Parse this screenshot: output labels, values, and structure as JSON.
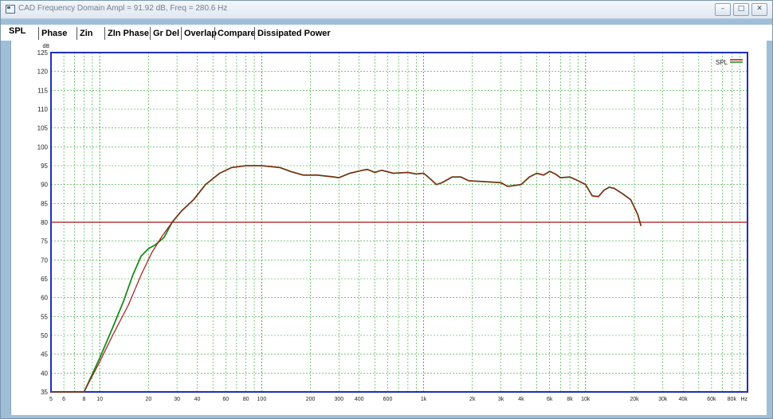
{
  "window": {
    "title": "CAD Frequency Domain   Ampl = 91.92 dB, Freq = 280.6 Hz",
    "controls": {
      "minimize": "–",
      "maximize": "□",
      "close": "✕"
    }
  },
  "tabs": [
    {
      "label": "SPL",
      "active": true
    },
    {
      "label": "Phase",
      "active": false
    },
    {
      "label": "Zin",
      "active": false
    },
    {
      "label": "ZIn Phase",
      "active": false
    },
    {
      "label": "Gr Del",
      "active": false
    },
    {
      "label": "Overlap",
      "active": false
    },
    {
      "label": "Compare",
      "active": false
    },
    {
      "label": "Dissipated Power",
      "active": false
    }
  ],
  "colors": {
    "plot_border": "#1f2fb8",
    "grid": "#2ea52e",
    "green_trace": "#1c8a1c",
    "red_trace": "#a01818",
    "axis_text": "#222222"
  },
  "chart_data": {
    "type": "line",
    "x_scale": "log",
    "xlabel_unit": "Hz",
    "ylabel_unit": "dB",
    "xlim": [
      5,
      100000
    ],
    "ylim": [
      35,
      125
    ],
    "grid": true,
    "legend": {
      "label": "SPL",
      "placement": "top-right"
    },
    "y_ticks": [
      35,
      40,
      45,
      50,
      55,
      60,
      65,
      70,
      75,
      80,
      85,
      90,
      95,
      100,
      105,
      110,
      115,
      120,
      125
    ],
    "x_tick_labels": [
      {
        "x": 5,
        "label": "5"
      },
      {
        "x": 6,
        "label": "6"
      },
      {
        "x": 8,
        "label": "8"
      },
      {
        "x": 10,
        "label": "10"
      },
      {
        "x": 20,
        "label": "20"
      },
      {
        "x": 30,
        "label": "30"
      },
      {
        "x": 40,
        "label": "40"
      },
      {
        "x": 60,
        "label": "60"
      },
      {
        "x": 80,
        "label": "80"
      },
      {
        "x": 100,
        "label": "100"
      },
      {
        "x": 200,
        "label": "200"
      },
      {
        "x": 300,
        "label": "300"
      },
      {
        "x": 400,
        "label": "400"
      },
      {
        "x": 600,
        "label": "600"
      },
      {
        "x": 1000,
        "label": "1k"
      },
      {
        "x": 2000,
        "label": "2k"
      },
      {
        "x": 3000,
        "label": "3k"
      },
      {
        "x": 4000,
        "label": "4k"
      },
      {
        "x": 6000,
        "label": "6k"
      },
      {
        "x": 8000,
        "label": "8k"
      },
      {
        "x": 10000,
        "label": "10k"
      },
      {
        "x": 20000,
        "label": "20k"
      },
      {
        "x": 30000,
        "label": "30k"
      },
      {
        "x": 40000,
        "label": "40k"
      },
      {
        "x": 60000,
        "label": "60k"
      },
      {
        "x": 80000,
        "label": "80k"
      },
      {
        "x": 100000,
        "label": "Hz"
      }
    ],
    "series": [
      {
        "color_key": "green_trace",
        "points": [
          [
            5,
            35
          ],
          [
            7,
            35
          ],
          [
            8,
            35
          ],
          [
            10,
            44
          ],
          [
            12,
            52
          ],
          [
            14,
            59
          ],
          [
            16,
            66
          ],
          [
            18,
            71
          ],
          [
            20,
            73
          ],
          [
            22,
            74
          ],
          [
            25,
            76
          ],
          [
            28,
            80
          ],
          [
            32,
            83
          ],
          [
            38,
            86
          ],
          [
            45,
            90
          ],
          [
            55,
            93
          ],
          [
            65,
            94.5
          ],
          [
            80,
            95
          ],
          [
            100,
            95
          ],
          [
            130,
            94.5
          ],
          [
            150,
            93.5
          ],
          [
            180,
            92.5
          ],
          [
            220,
            92.5
          ],
          [
            280,
            92
          ],
          [
            300,
            91.8
          ],
          [
            350,
            93
          ],
          [
            420,
            93.8
          ],
          [
            450,
            94
          ],
          [
            500,
            93.2
          ],
          [
            550,
            93.8
          ],
          [
            650,
            93
          ],
          [
            800,
            93.2
          ],
          [
            900,
            92.8
          ],
          [
            1000,
            93
          ],
          [
            1100,
            91.5
          ],
          [
            1200,
            90
          ],
          [
            1300,
            90.5
          ],
          [
            1500,
            92
          ],
          [
            1700,
            92
          ],
          [
            1900,
            91
          ],
          [
            2300,
            90.8
          ],
          [
            3000,
            90.5
          ],
          [
            3300,
            89.5
          ],
          [
            4000,
            90
          ],
          [
            4500,
            92
          ],
          [
            5000,
            93
          ],
          [
            5500,
            92.5
          ],
          [
            6000,
            93.5
          ],
          [
            6500,
            92.8
          ],
          [
            7000,
            91.8
          ],
          [
            8000,
            92
          ],
          [
            9000,
            91
          ],
          [
            10000,
            90
          ],
          [
            11000,
            87
          ],
          [
            12000,
            86.8
          ],
          [
            13000,
            88.5
          ],
          [
            14000,
            89.3
          ],
          [
            15000,
            89
          ],
          [
            17000,
            87.5
          ],
          [
            19000,
            86
          ],
          [
            20000,
            84
          ],
          [
            21000,
            82
          ],
          [
            22000,
            79
          ]
        ]
      },
      {
        "color_key": "red_trace",
        "points": [
          [
            5,
            35
          ],
          [
            8,
            35
          ],
          [
            10,
            43
          ],
          [
            12,
            50
          ],
          [
            15,
            58
          ],
          [
            18,
            66
          ],
          [
            21,
            72
          ],
          [
            24,
            76
          ],
          [
            28,
            80
          ],
          [
            32,
            83
          ],
          [
            38,
            86
          ],
          [
            45,
            90
          ],
          [
            55,
            93
          ],
          [
            65,
            94.5
          ],
          [
            80,
            95
          ],
          [
            100,
            95
          ],
          [
            130,
            94.5
          ],
          [
            150,
            93.5
          ],
          [
            180,
            92.5
          ],
          [
            220,
            92.5
          ],
          [
            280,
            92
          ],
          [
            300,
            91.8
          ],
          [
            350,
            93
          ],
          [
            420,
            93.8
          ],
          [
            450,
            94
          ],
          [
            500,
            93.2
          ],
          [
            550,
            93.8
          ],
          [
            650,
            93
          ],
          [
            800,
            93.2
          ],
          [
            900,
            92.8
          ],
          [
            1000,
            93
          ],
          [
            1100,
            91.5
          ],
          [
            1200,
            90
          ],
          [
            1300,
            90.5
          ],
          [
            1500,
            92
          ],
          [
            1700,
            92
          ],
          [
            1900,
            91
          ],
          [
            2300,
            90.8
          ],
          [
            3000,
            90.5
          ],
          [
            3300,
            89.5
          ],
          [
            4000,
            90
          ],
          [
            4500,
            92
          ],
          [
            5000,
            93
          ],
          [
            5500,
            92.5
          ],
          [
            6000,
            93.5
          ],
          [
            6500,
            92.8
          ],
          [
            7000,
            91.8
          ],
          [
            8000,
            92
          ],
          [
            9000,
            91
          ],
          [
            10000,
            90
          ],
          [
            11000,
            87
          ],
          [
            12000,
            86.8
          ],
          [
            13000,
            88.5
          ],
          [
            14000,
            89.3
          ],
          [
            15000,
            89
          ],
          [
            17000,
            87.5
          ],
          [
            19000,
            86
          ],
          [
            20000,
            84
          ],
          [
            21000,
            82
          ],
          [
            22000,
            79
          ]
        ]
      },
      {
        "color_key": "red_trace",
        "points": [
          [
            5,
            80
          ],
          [
            100000,
            80
          ]
        ]
      }
    ]
  }
}
